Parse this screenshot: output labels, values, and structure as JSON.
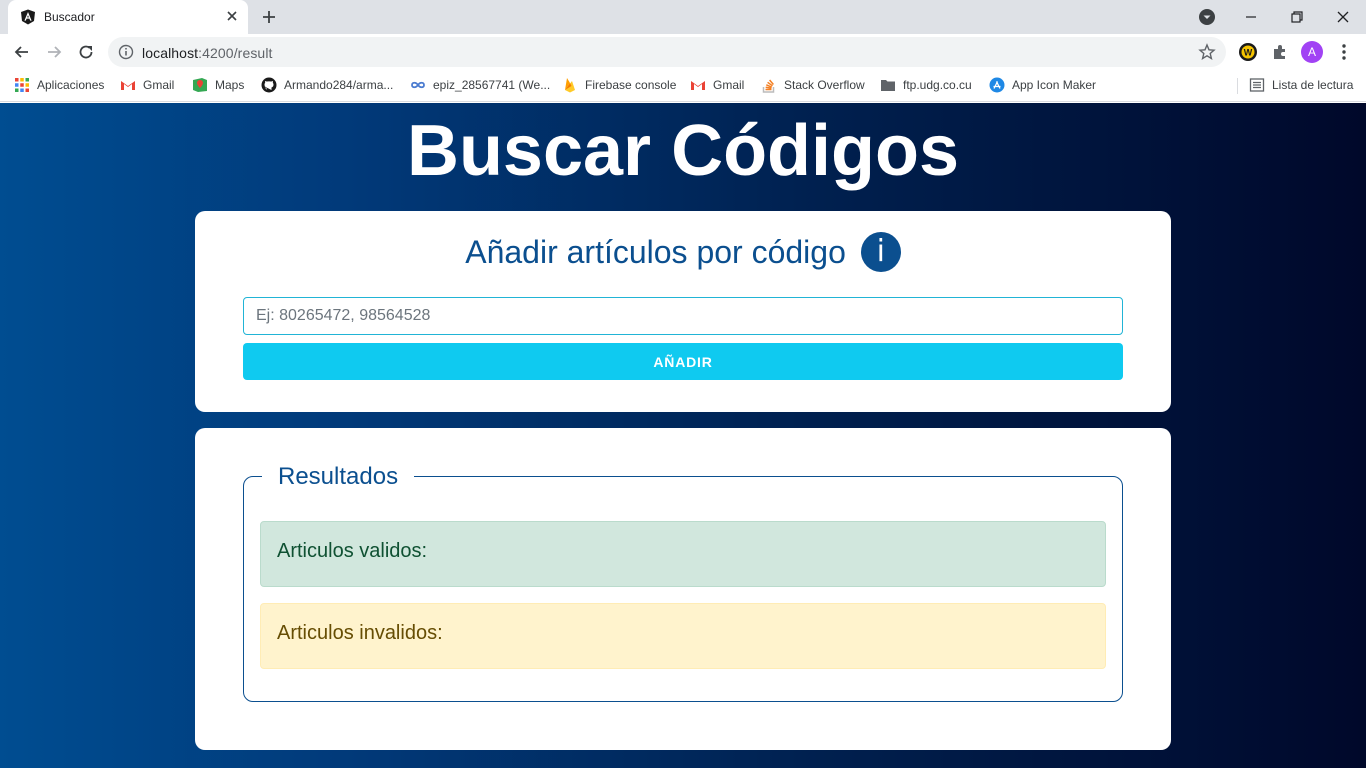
{
  "browser": {
    "tab": {
      "title": "Buscador"
    },
    "address": {
      "host": "localhost",
      "path": ":4200/result"
    },
    "profile_initial": "A",
    "bookmarks": [
      {
        "label": "Aplicaciones",
        "icon": "apps-grid-icon"
      },
      {
        "label": "Gmail",
        "icon": "gmail-icon"
      },
      {
        "label": "Maps",
        "icon": "maps-icon"
      },
      {
        "label": "Armando284/arma...",
        "icon": "github-icon"
      },
      {
        "label": "epiz_28567741 (We...",
        "icon": "infinity-icon"
      },
      {
        "label": "Firebase console",
        "icon": "firebase-icon"
      },
      {
        "label": "Gmail",
        "icon": "gmail-icon"
      },
      {
        "label": "Stack Overflow",
        "icon": "stackoverflow-icon"
      },
      {
        "label": "ftp.udg.co.cu",
        "icon": "folder-icon"
      },
      {
        "label": "App Icon Maker",
        "icon": "appstore-icon"
      }
    ],
    "reading_list": {
      "label": "Lista de lectura",
      "icon": "reading-list-icon"
    }
  },
  "page": {
    "title": "Buscar Códigos",
    "add_card": {
      "title": "Añadir artículos por código",
      "info_glyph": "i",
      "input_placeholder": "Ej: 80265472, 98564528",
      "input_value": "",
      "button_label": "AÑADIR"
    },
    "results": {
      "legend": "Resultados",
      "valid_label": "Articulos validos:",
      "invalid_label": "Articulos invalidos:"
    }
  },
  "colors": {
    "brand_blue": "#0b4f8f",
    "button_cyan": "#0fcaf0",
    "valid_bg": "#d1e7dd",
    "invalid_bg": "#fff3cd"
  }
}
